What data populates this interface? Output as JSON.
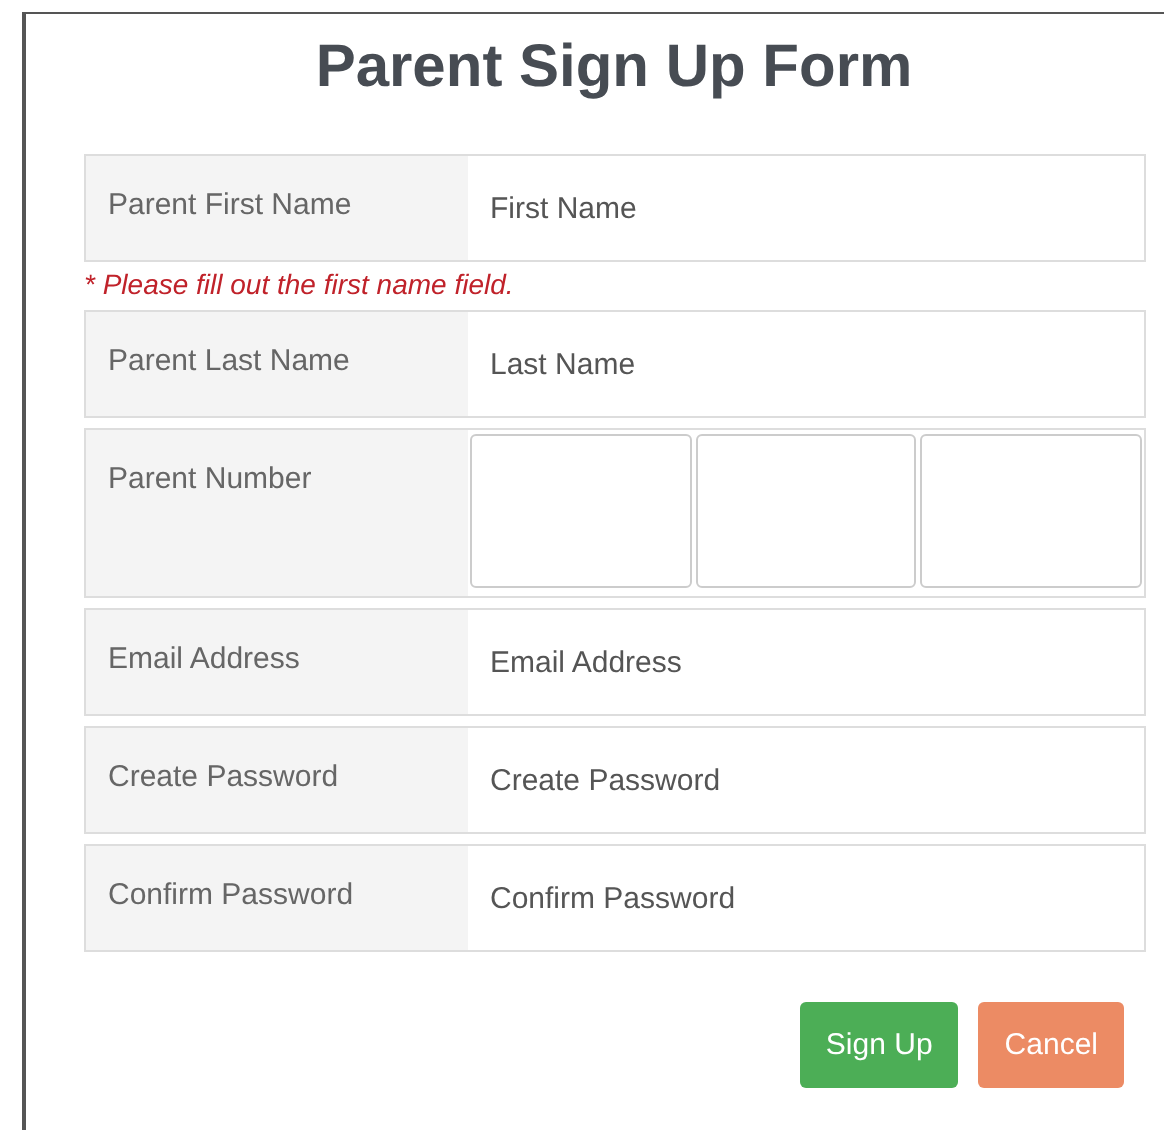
{
  "form": {
    "title": "Parent Sign Up Form",
    "fields": [
      {
        "kind": "text",
        "label": "Parent First Name",
        "placeholder": "First Name",
        "error": "* Please fill out the first name field."
      },
      {
        "kind": "text",
        "label": "Parent Last Name",
        "placeholder": "Last Name"
      },
      {
        "kind": "phone",
        "label": "Parent Number"
      },
      {
        "kind": "text",
        "label": "Email Address",
        "placeholder": "Email Address"
      },
      {
        "kind": "text",
        "label": "Create Password",
        "placeholder": "Create Password"
      },
      {
        "kind": "text",
        "label": "Confirm Password",
        "placeholder": "Confirm Password"
      }
    ],
    "buttons": [
      {
        "kind": "primary",
        "label": "Sign Up"
      },
      {
        "kind": "danger",
        "label": "Cancel"
      }
    ]
  }
}
